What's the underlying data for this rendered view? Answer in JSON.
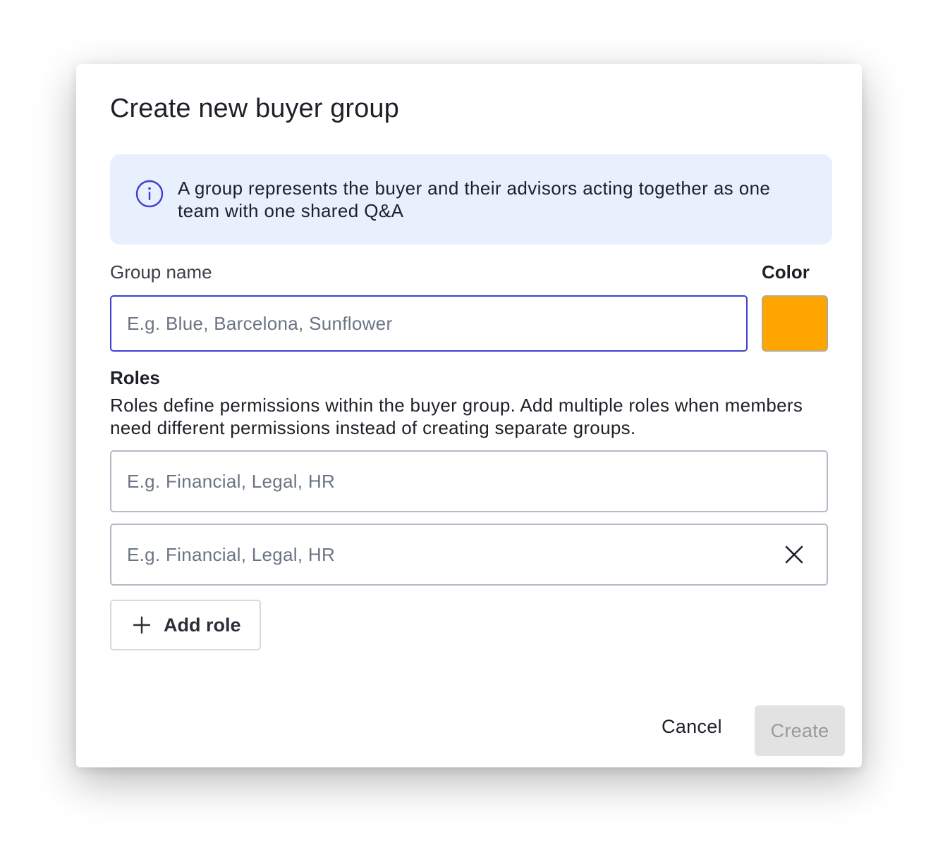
{
  "dialog": {
    "title": "Create new buyer group",
    "info_text": "A group represents the buyer and their advisors acting together as one team with one shared Q&A",
    "group_name": {
      "label": "Group name",
      "value": "",
      "placeholder": "E.g. Blue, Barcelona, Sunflower"
    },
    "color": {
      "label": "Color",
      "value": "#FFA500"
    },
    "roles": {
      "label": "Roles",
      "description": "Roles define permissions within the buyer group. Add multiple roles when members need different permissions instead of creating separate groups.",
      "inputs": [
        {
          "value": "",
          "placeholder": "E.g. Financial, Legal, HR",
          "removable": false
        },
        {
          "value": "",
          "placeholder": "E.g. Financial, Legal, HR",
          "removable": true
        }
      ],
      "add_label": "Add role",
      "add_icon": "plus-icon",
      "remove_icon": "close-icon"
    },
    "footer": {
      "cancel_label": "Cancel",
      "create_label": "Create",
      "create_disabled": true
    }
  },
  "colors": {
    "accent": "#3C3FD1",
    "info_bg": "#E8EFFD",
    "swatch": "#FFA500",
    "disabled_bg": "#E2E2E2",
    "disabled_text": "#9A9A9A"
  }
}
